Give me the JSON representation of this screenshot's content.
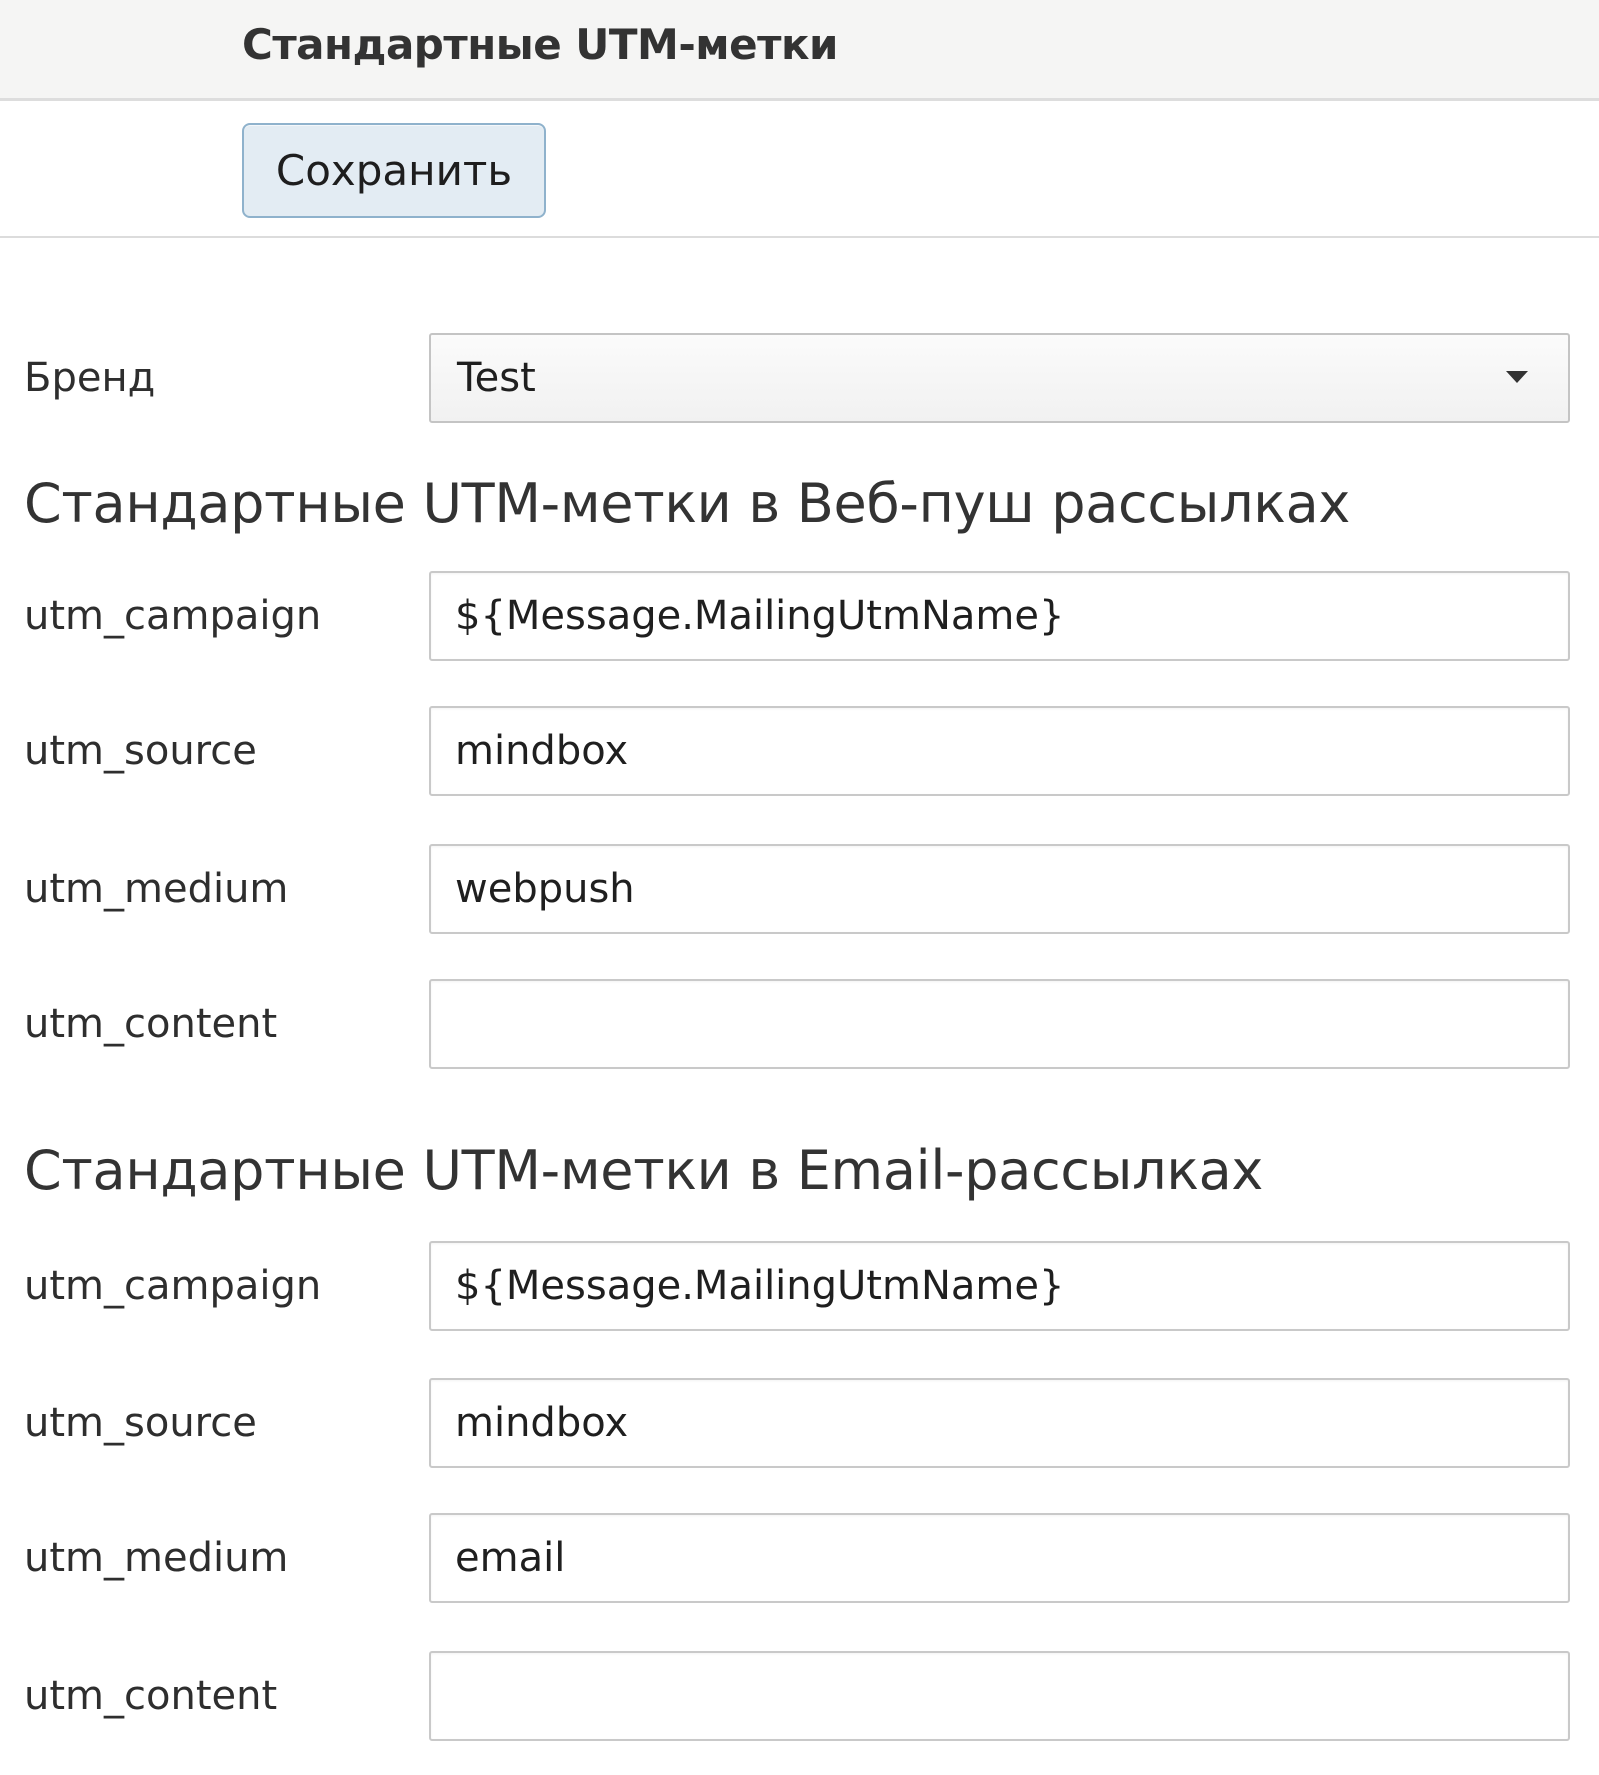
{
  "header": {
    "title": "Стандартные UTM-метки"
  },
  "toolbar": {
    "save_label": "Сохранить"
  },
  "brand": {
    "label": "Бренд",
    "value": "Test"
  },
  "webpush": {
    "title": "Стандартные UTM-метки в Веб-пуш рассылках",
    "campaign_label": "utm_campaign",
    "campaign_value": "${Message.MailingUtmName}",
    "source_label": "utm_source",
    "source_value": "mindbox",
    "medium_label": "utm_medium",
    "medium_value": "webpush",
    "content_label": "utm_content",
    "content_value": ""
  },
  "email": {
    "title": "Стандартные UTM-метки в Email-рассылках",
    "campaign_label": "utm_campaign",
    "campaign_value": "${Message.MailingUtmName}",
    "source_label": "utm_source",
    "source_value": "mindbox",
    "medium_label": "utm_medium",
    "medium_value": "email",
    "content_label": "utm_content",
    "content_value": ""
  }
}
